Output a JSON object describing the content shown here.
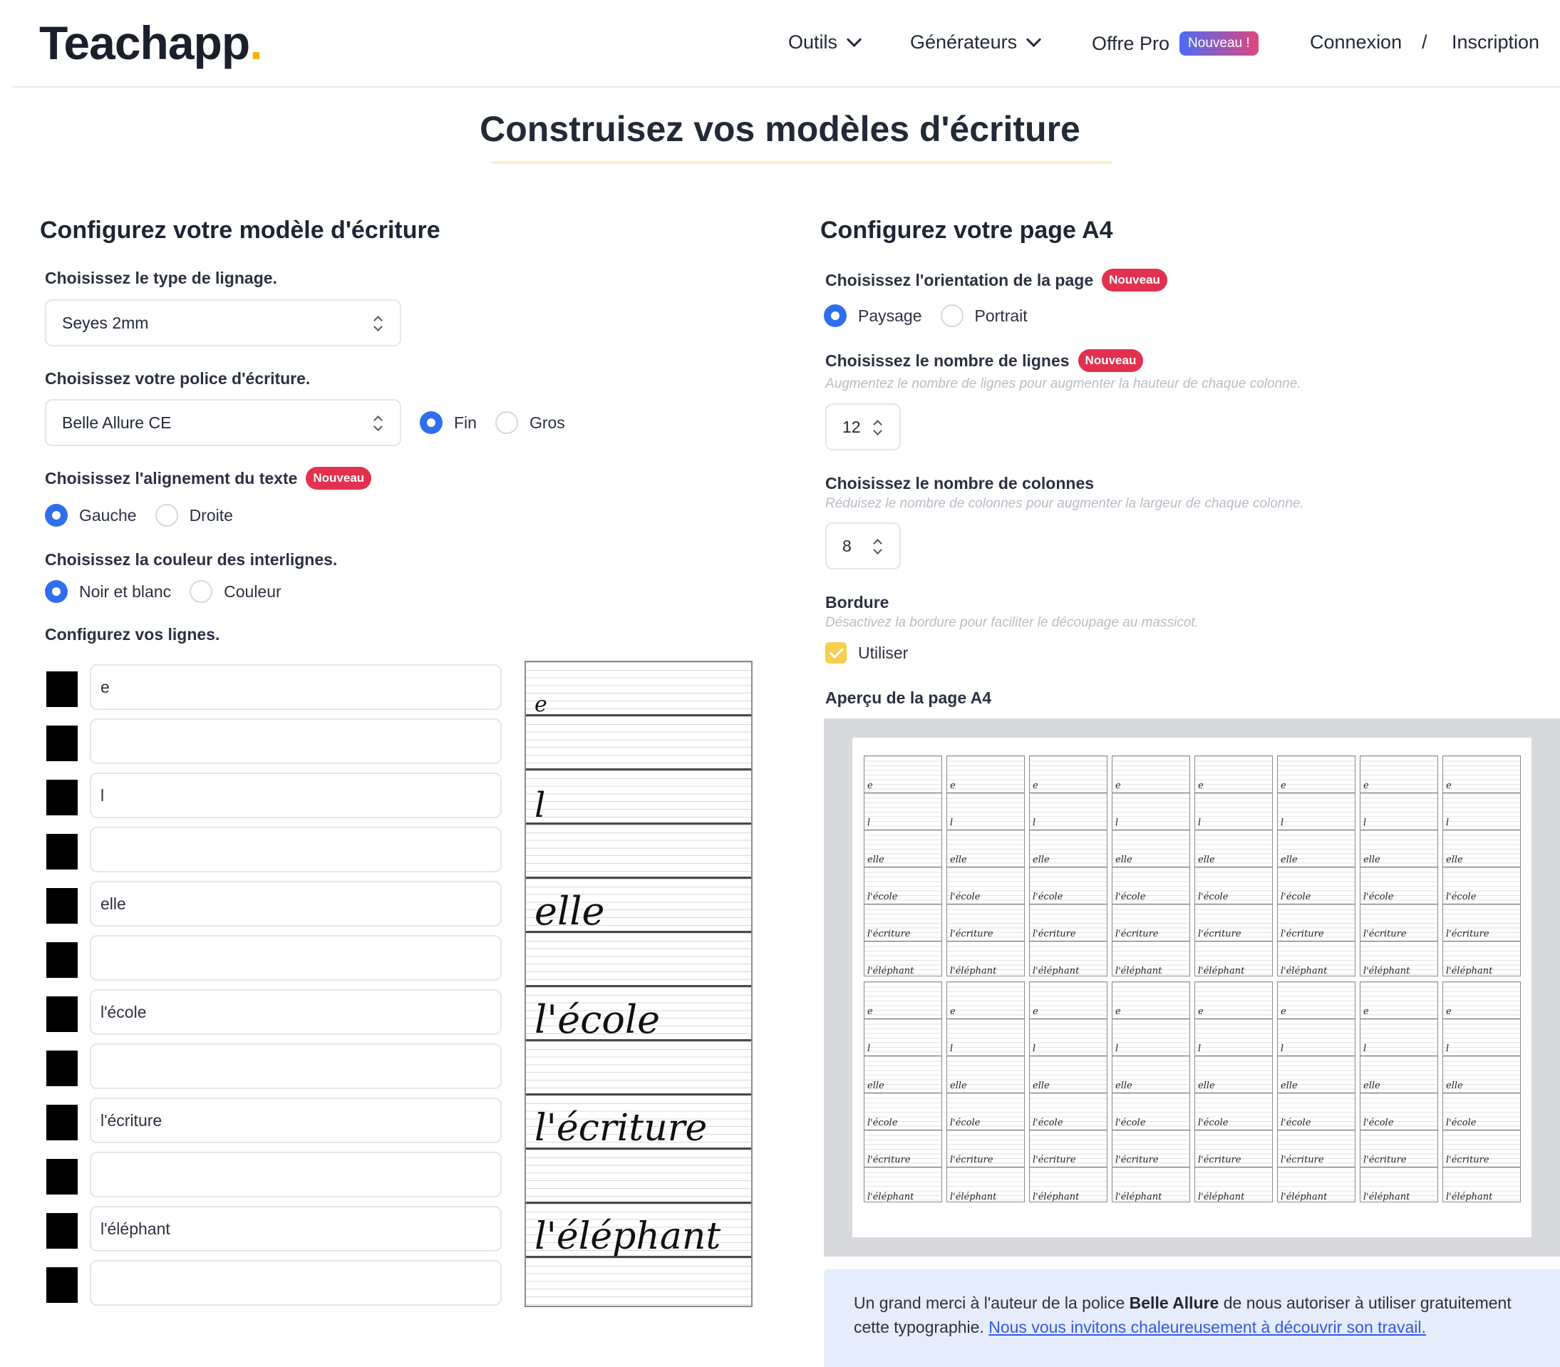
{
  "header": {
    "logo_text": "Teachapp",
    "logo_dot": ".",
    "nav": {
      "outils": "Outils",
      "generateurs": "Générateurs",
      "offre_pro": "Offre Pro",
      "offre_pro_badge": "Nouveau !",
      "connexion": "Connexion",
      "separator": "/",
      "inscription": "Inscription"
    }
  },
  "page_title": "Construisez vos modèles d'écriture",
  "left": {
    "heading": "Configurez votre modèle d'écriture",
    "lignage": {
      "label": "Choisissez le type de lignage.",
      "value": "Seyes 2mm"
    },
    "police": {
      "label": "Choisissez votre police d'écriture.",
      "value": "Belle Allure CE",
      "options": [
        {
          "label": "Fin",
          "checked": true
        },
        {
          "label": "Gros",
          "checked": false
        }
      ]
    },
    "alignement": {
      "label": "Choisissez l'alignement du texte",
      "badge": "Nouveau",
      "options": [
        {
          "label": "Gauche",
          "checked": true
        },
        {
          "label": "Droite",
          "checked": false
        }
      ]
    },
    "couleur": {
      "label": "Choisissez la couleur des interlignes.",
      "options": [
        {
          "label": "Noir et blanc",
          "checked": true
        },
        {
          "label": "Couleur",
          "checked": false
        }
      ]
    },
    "lignes": {
      "label": "Configurez vos lignes.",
      "rows": [
        "e",
        "",
        "l",
        "",
        "elle",
        "",
        "l'école",
        "",
        "l'écriture",
        "",
        "l'éléphant",
        ""
      ]
    },
    "preview_words": [
      "e",
      "l",
      "elle",
      "l'école",
      "l'écriture",
      "l'éléphant"
    ]
  },
  "right": {
    "heading": "Configurez votre page A4",
    "orientation": {
      "label": "Choisissez l'orientation de la page",
      "badge": "Nouveau",
      "options": [
        {
          "label": "Paysage",
          "checked": true
        },
        {
          "label": "Portrait",
          "checked": false
        }
      ]
    },
    "nb_lignes": {
      "label": "Choisissez le nombre de lignes",
      "badge": "Nouveau",
      "help": "Augmentez le nombre de lignes pour augmenter la hauteur de chaque colonne.",
      "value": "12"
    },
    "nb_colonnes": {
      "label": "Choisissez le nombre de colonnes",
      "help": "Réduisez le nombre de colonnes pour augmenter la largeur de chaque colonne.",
      "value": "8"
    },
    "bordure": {
      "label": "Bordure",
      "help": "Désactivez la bordure pour faciliter le découpage au massicot.",
      "checkbox_label": "Utiliser",
      "checked": true
    },
    "apercu_label": "Aperçu de la page A4",
    "info": {
      "text_before": "Un grand merci à l'auteur de la police ",
      "font_name": "Belle Allure",
      "text_after": " de nous autoriser à utiliser gratuitement cette typographie. ",
      "link": "Nous vous invitons chaleureusement à découvrir son travail."
    }
  },
  "colors": {
    "accent_blue": "#2f6fed",
    "badge_red": "#e2314f",
    "checkbox_yellow": "#f8ce4f",
    "info_bg": "#e5ecfb"
  }
}
